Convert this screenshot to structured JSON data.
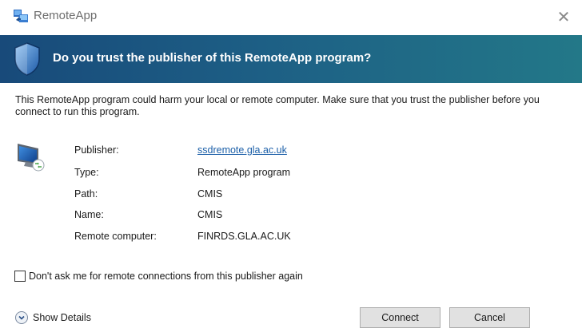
{
  "window": {
    "title": "RemoteApp",
    "close_glyph": "✕",
    "app_icon": "remoteapp-icon"
  },
  "banner": {
    "heading": "Do you trust the publisher of this RemoteApp program?",
    "icon": "shield-icon",
    "gradient": [
      "#184a7a",
      "#237888"
    ]
  },
  "warning": {
    "text": "This RemoteApp program could harm your local or remote computer. Make sure that you trust the publisher before you connect to run this program."
  },
  "details": {
    "icon": "remote-computer-icon",
    "rows": [
      {
        "label": "Publisher:",
        "value": "ssdremote.gla.ac.uk"
      },
      {
        "label": "Type:",
        "value": "RemoteApp program"
      },
      {
        "label": "Path:",
        "value": "CMIS"
      },
      {
        "label": "Name:",
        "value": "CMIS"
      },
      {
        "label": "Remote computer:",
        "value": "FINRDS.GLA.AC.UK"
      }
    ]
  },
  "dont_ask": {
    "label": "Don't ask me for remote connections from this publisher again",
    "checked": false
  },
  "show_details": {
    "label": "Show Details"
  },
  "buttons": {
    "connect": "Connect",
    "cancel": "Cancel"
  },
  "colors": {
    "link": "#1b5fa8",
    "button_bg": "#e1e1e1"
  }
}
